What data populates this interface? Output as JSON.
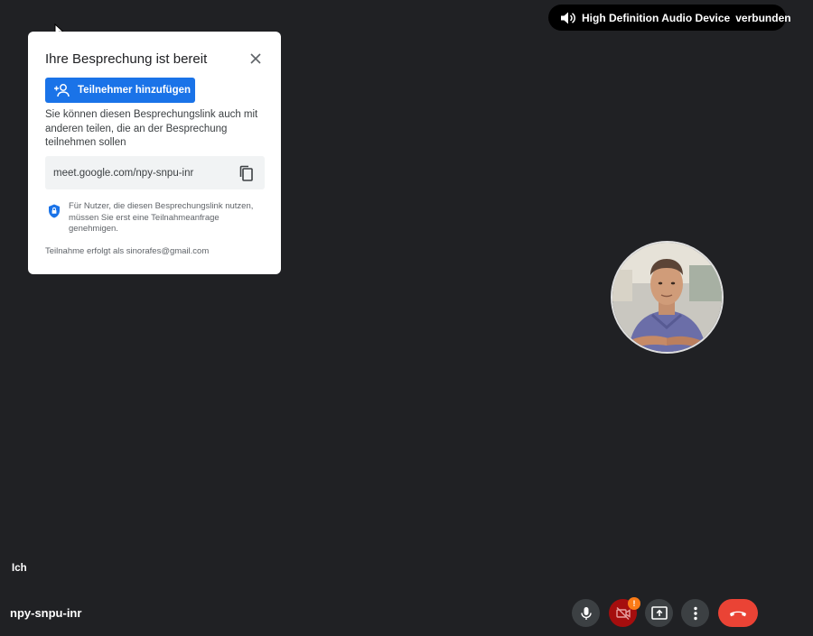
{
  "audio_status": {
    "device": "High Definition Audio Device",
    "status": "verbunden",
    "icon": "speaker-icon"
  },
  "meeting_card": {
    "title": "Ihre Besprechung ist bereit",
    "add_button_label": "Teilnehmer hinzufügen",
    "description": "Sie können diesen Besprechungslink auch mit anderen teilen, die an der Besprechung teilnehmen sollen",
    "link": "meet.google.com/npy-snpu-inr",
    "security_note": "Für Nutzer, die diesen Besprechungslink nutzen, müssen Sie erst eine Teilnahmeanfrage genehmigen.",
    "joined_as": "Teilnahme erfolgt als sinorafes@gmail.com",
    "icons": [
      "close-icon",
      "add-person-icon",
      "copy-icon",
      "shield-icon"
    ]
  },
  "self": {
    "label": "Ich"
  },
  "meeting_code": "npy-snpu-inr",
  "controls": {
    "warning_badge": "!",
    "icons": [
      "microphone-icon",
      "camera-off-icon",
      "present-screen-icon",
      "more-options-icon",
      "hang-up-icon"
    ]
  },
  "colors": {
    "background": "#202124",
    "primary": "#1a73e8",
    "hangup": "#ea4335",
    "camera_off": "#a50e0e",
    "warning": "#fa7b17"
  }
}
